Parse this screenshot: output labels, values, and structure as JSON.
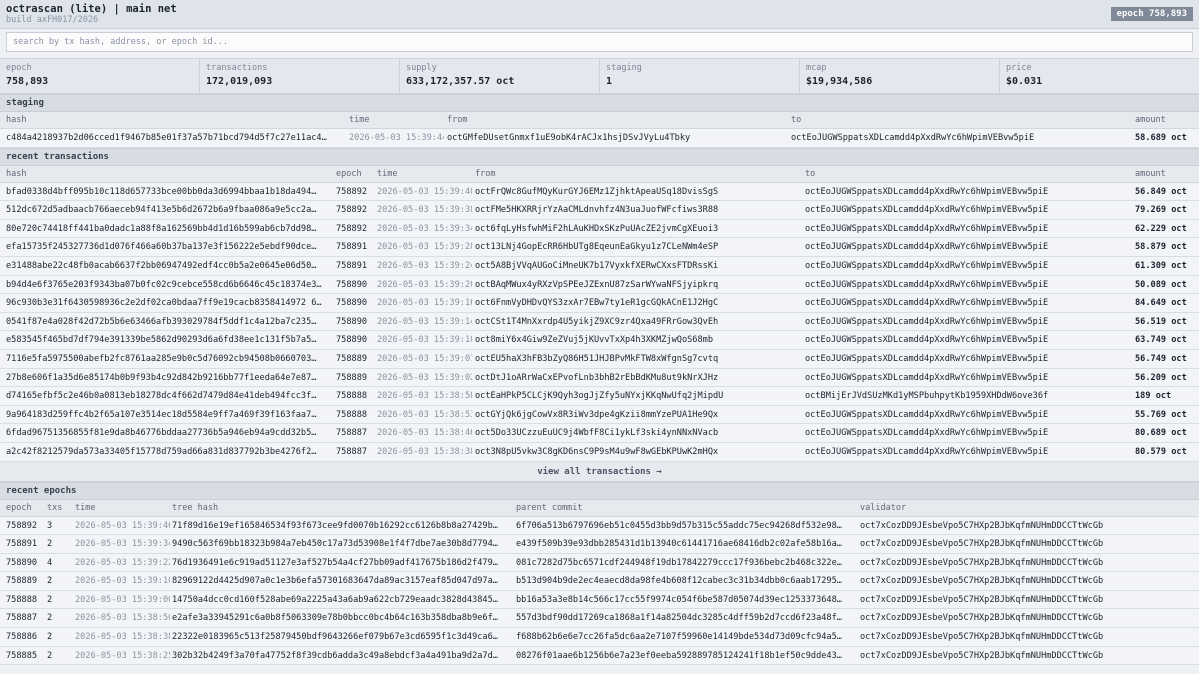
{
  "header": {
    "title": "octrascan (lite) | main net",
    "build": "build axFH017/2026",
    "epoch_badge": "epoch 758,893"
  },
  "search": {
    "placeholder": "search by tx hash, address, or epoch id..."
  },
  "stats": [
    {
      "label": "epoch",
      "value": "758,893"
    },
    {
      "label": "transactions",
      "value": "172,019,093"
    },
    {
      "label": "supply",
      "value": "633,172,357.57 oct"
    },
    {
      "label": "staging",
      "value": "1"
    },
    {
      "label": "mcap",
      "value": "$19,934,586"
    },
    {
      "label": "price",
      "value": "$0.031"
    }
  ],
  "staging": {
    "title": "staging",
    "columns": [
      "hash",
      "time",
      "from",
      "to",
      "amount"
    ],
    "rows": [
      {
        "hash": "c484a4218937b2d06cced1f9467b85e01f37a57b71bcd794d5f7c27e11ac4…",
        "time": "2026-05-03 15:39:44",
        "from": "octGMfeDUsetGnmxf1uE9obK4rACJx1hsjDSvJVyLu4Tbky",
        "to": "octEoJUGWSppatsXDLcamdd4pXxdRwYc6hWpimVEBvw5piE",
        "amount": "58.689 oct"
      }
    ]
  },
  "transactions": {
    "title": "recent transactions",
    "columns": [
      "hash",
      "epoch",
      "time",
      "from",
      "to",
      "amount"
    ],
    "rows": [
      {
        "hash": "bfad0338d4bff095b10c118d657733bce00bb0da3d6994bbaa1b18da494…",
        "epoch": "758892",
        "time": "2026-05-03 15:39:40",
        "from": "octFrQWc8GufMQyKurGYJ6EMz1ZjhktApeaUSq18DvisSgS",
        "to": "octEoJUGWSppatsXDLcamdd4pXxdRwYc6hWpimVEBvw5piE",
        "amount": "56.849 oct"
      },
      {
        "hash": "512dc672d5adbaacb766aeceb94f413e5b6d2672b6a9fbaa086a9e5cc2a…",
        "epoch": "758892",
        "time": "2026-05-03 15:39:38",
        "from": "octFMe5HKXRRjrYzAaCMLdnvhfz4N3uaJuofWFcfiws3R88",
        "to": "octEoJUGWSppatsXDLcamdd4pXxdRwYc6hWpimVEBvw5piE",
        "amount": "79.269 oct"
      },
      {
        "hash": "80e720c74418ff441ba0dadc1a88f8a162569bb4d1d16b599ab6cb7dd98…",
        "epoch": "758892",
        "time": "2026-05-03 15:39:34",
        "from": "oct6fqLyHsfwhMiF2hLAuKHDxSKzPuUAcZE2jvmCgXEuoi3",
        "to": "octEoJUGWSppatsXDLcamdd4pXxdRwYc6hWpimVEBvw5piE",
        "amount": "62.229 oct"
      },
      {
        "hash": "efa15735f245327736d1d076f466a60b37ba137e3f156222e5ebdf90dce…",
        "epoch": "758891",
        "time": "2026-05-03 15:39:28",
        "from": "oct13LNj4GopEcRR6HbUTg8EqeunEaGkyu1z7CLeNWm4eSP",
        "to": "octEoJUGWSppatsXDLcamdd4pXxdRwYc6hWpimVEBvw5piE",
        "amount": "58.879 oct"
      },
      {
        "hash": "e31488abe22c48fb0acab6637f2bb06947492edf4cc0b5a2e0645e06d50…",
        "epoch": "758891",
        "time": "2026-05-03 15:39:24",
        "from": "oct5A8BjVVqAUGoCiMneUK7b17VyxkfXERwCXxsFTDRssKi",
        "to": "octEoJUGWSppatsXDLcamdd4pXxdRwYc6hWpimVEBvw5piE",
        "amount": "61.309 oct"
      },
      {
        "hash": "b94d4e6f3765e203f9343ba07b0fc02c9cebce558cd6b6646c45c18374e3…",
        "epoch": "758890",
        "time": "2026-05-03 15:39:20",
        "from": "octBAqMWux4yRXzVpSPEeJZExnU87zSarWYwaNFSjyipkrq",
        "to": "octEoJUGWSppatsXDLcamdd4pXxdRwYc6hWpimVEBvw5piE",
        "amount": "50.089 oct"
      },
      {
        "hash": "96c930b3e31f6430598936c2e2df02ca0bdaa7ff9e19cacb8358414972 6…",
        "epoch": "758890",
        "time": "2026-05-03 15:39:16",
        "from": "oct6FnmVyDHDvQYS3zxAr7EBw7ty1eR1gcGQkACnE1J2HgC",
        "to": "octEoJUGWSppatsXDLcamdd4pXxdRwYc6hWpimVEBvw5piE",
        "amount": "84.649 oct"
      },
      {
        "hash": "0541f87e4a028f42d72b5b6e63466afb393029784f5ddf1c4a12ba7c235…",
        "epoch": "758890",
        "time": "2026-05-03 15:39:14",
        "from": "octCSt1T4MnXxrdp4U5yikjZ9XC9zr4Qxa49FRrGow3QvEh",
        "to": "octEoJUGWSppatsXDLcamdd4pXxdRwYc6hWpimVEBvw5piE",
        "amount": "56.519 oct"
      },
      {
        "hash": "e583545f465bd7df794e391339be5862d90293d6a6fd38ee1c131f5b7a5…",
        "epoch": "758890",
        "time": "2026-05-03 15:39:10",
        "from": "oct8miY6x4Giw9ZeZVuj5jKUvvTxXp4h3XKMZjwQoS68mb",
        "to": "octEoJUGWSppatsXDLcamdd4pXxdRwYc6hWpimVEBvw5piE",
        "amount": "63.749 oct"
      },
      {
        "hash": "7116e5fa5975500abefb2fc8761aa285e9b0c5d76092cb94508b0660703…",
        "epoch": "758889",
        "time": "2026-05-03 15:39:07",
        "from": "octEU5haX3hFB3bZyQ86H51JHJBPvMkFTW8xWfgnSg7cvtq",
        "to": "octEoJUGWSppatsXDLcamdd4pXxdRwYc6hWpimVEBvw5piE",
        "amount": "56.749 oct"
      },
      {
        "hash": "27b8e606f1a35d6e85174b0b9f93b4c92d842b9216bb77f1eeda64e7e87…",
        "epoch": "758889",
        "time": "2026-05-03 15:39:02",
        "from": "octDtJ1oARrWaCxEPvofLnb3bhB2rEbBdKMu8ut9kNrXJHz",
        "to": "octEoJUGWSppatsXDLcamdd4pXxdRwYc6hWpimVEBvw5piE",
        "amount": "56.209 oct"
      },
      {
        "hash": "d74165efbf5c2e46b0a0813eb18278dc4f662d7479d84e41deb494fcc3f…",
        "epoch": "758888",
        "time": "2026-05-03 15:38:58",
        "from": "octEaHPkP5CLCjK9Qyh3ogJjZfy5uNYxjKKqNwUfq2jMipdU",
        "to": "octBMijErJVdSUzMKd1yMSPbuhpytKb1959XHDdW6ove36f",
        "amount": "189 oct"
      },
      {
        "hash": "9a964183d259ffc4b2f65a107e3514ec18d5584e9ff7a469f39f163faa7…",
        "epoch": "758888",
        "time": "2026-05-03 15:38:53",
        "from": "octGYjQk6jgCowVx8R3iWv3dpe4gKzii8mmYzePUA1He9Qx",
        "to": "octEoJUGWSppatsXDLcamdd4pXxdRwYc6hWpimVEBvw5piE",
        "amount": "55.769 oct"
      },
      {
        "hash": "6fdad96751356855f81e9da8b46776bddaa27736b5a946eb94a9cdd32b5…",
        "epoch": "758887",
        "time": "2026-05-03 15:38:46",
        "from": "oct5Do33UCzzuEuUC9j4WbfF8Ci1ykLf3ski4ynNNxNVacb",
        "to": "octEoJUGWSppatsXDLcamdd4pXxdRwYc6hWpimVEBvw5piE",
        "amount": "80.689 oct"
      },
      {
        "hash": "a2c42f8212579da573a33405f15778d759ad66a831d837792b3be4276f2…",
        "epoch": "758887",
        "time": "2026-05-03 15:38:38",
        "from": "oct3N8pU5vkw3C8gKD6nsC9P9sM4u9wF8wGEbKPUwK2mHQx",
        "to": "octEoJUGWSppatsXDLcamdd4pXxdRwYc6hWpimVEBvw5piE",
        "amount": "80.579 oct"
      }
    ],
    "view_all": "view all transactions →"
  },
  "epochs": {
    "title": "recent epochs",
    "columns": [
      "epoch",
      "txs",
      "time",
      "tree hash",
      "parent commit",
      "validator"
    ],
    "rows": [
      {
        "epoch": "758892",
        "txs": "3",
        "time": "2026-05-03 15:39:46",
        "tree": "71f89d16e19ef165846534f93f673cee9fd0070b16292cc6126b8b8a27429b…",
        "parent": "6f706a513b6797696eb51c0455d3bb9d57b315c55addc75ec94268df532e98…",
        "validator": "oct7xCozDD9JEsbeVpo5C7HXp2BJbKqfmNUHmDDCCTtWcGb"
      },
      {
        "epoch": "758891",
        "txs": "2",
        "time": "2026-05-03 15:39:34",
        "tree": "9490c563f69bb18323b984a7eb450c17a73d53908e1f4f7dbe7ae30b8d7794…",
        "parent": "e439f509b39e93dbb285431d1b13940c61441716ae68416db2c02afe58b16a…",
        "validator": "oct7xCozDD9JEsbeVpo5C7HXp2BJbKqfmNUHmDDCCTtWcGb"
      },
      {
        "epoch": "758890",
        "txs": "4",
        "time": "2026-05-03 15:39:22",
        "tree": "76d1936491e6c919ad51127e3af527b54a4cf27bb09adf417675b186d2f479…",
        "parent": "081c7282d75bc6571cdf244948f19db17842279ccc17f936bebc2b468c322e…",
        "validator": "oct7xCozDD9JEsbeVpo5C7HXp2BJbKqfmNUHmDDCCTtWcGb"
      },
      {
        "epoch": "758889",
        "txs": "2",
        "time": "2026-05-03 15:39:10",
        "tree": "82969122d4425d907a0c1e3b6efa57301683647da89ac3157eaf85d047d97a…",
        "parent": "b513d904b9de2ec4eaecd8da98fe4b608f12cabec3c31b34dbb0c6aab17295…",
        "validator": "oct7xCozDD9JEsbeVpo5C7HXp2BJbKqfmNUHmDDCCTtWcGb"
      },
      {
        "epoch": "758888",
        "txs": "2",
        "time": "2026-05-03 15:39:00",
        "tree": "14750a4dcc0cd160f528abe69a2225a43a6ab9a622cb729eaadc3828d43845…",
        "parent": "bb16a53a3e8b14c566c17cc55f9974c054f6be587d05074d39ec1253373648…",
        "validator": "oct7xCozDD9JEsbeVpo5C7HXp2BJbKqfmNUHmDDCCTtWcGb"
      },
      {
        "epoch": "758887",
        "txs": "2",
        "time": "2026-05-03 15:38:50",
        "tree": "e2afe3a33945291c6a0b8f5063309e78b0bbcc0bc4b64c163b358dba8b9e6f…",
        "parent": "557d3bdf90dd17269ca1868a1f14a82504dc3285c4dff59b2d7ccd6f23a48f…",
        "validator": "oct7xCozDD9JEsbeVpo5C7HXp2BJbKqfmNUHmDDCCTtWcGb"
      },
      {
        "epoch": "758886",
        "txs": "2",
        "time": "2026-05-03 15:38:38",
        "tree": "22322e0183965c513f25879450bdf9643266ef079b67e3cd6595f1c3d49ca6…",
        "parent": "f688b62b6e6e7cc26fa5dc6aa2e7107f59960e14149bde534d73d09cfc94a5…",
        "validator": "oct7xCozDD9JEsbeVpo5C7HXp2BJbKqfmNUHmDDCCTtWcGb"
      },
      {
        "epoch": "758885",
        "txs": "2",
        "time": "2026-05-03 15:38:25",
        "tree": "302b32b4249f3a70fa47752f8f39cdb6adda3c49a8ebdcf3a4a491ba9d2a7d…",
        "parent": "08276f01aae6b1256b6e7a23ef0eeba592889785124241f18b1ef50c9dde43…",
        "validator": "oct7xCozDD9JEsbeVpo5C7HXp2BJbKqfmNUHmDDCCTtWcGb"
      }
    ]
  }
}
